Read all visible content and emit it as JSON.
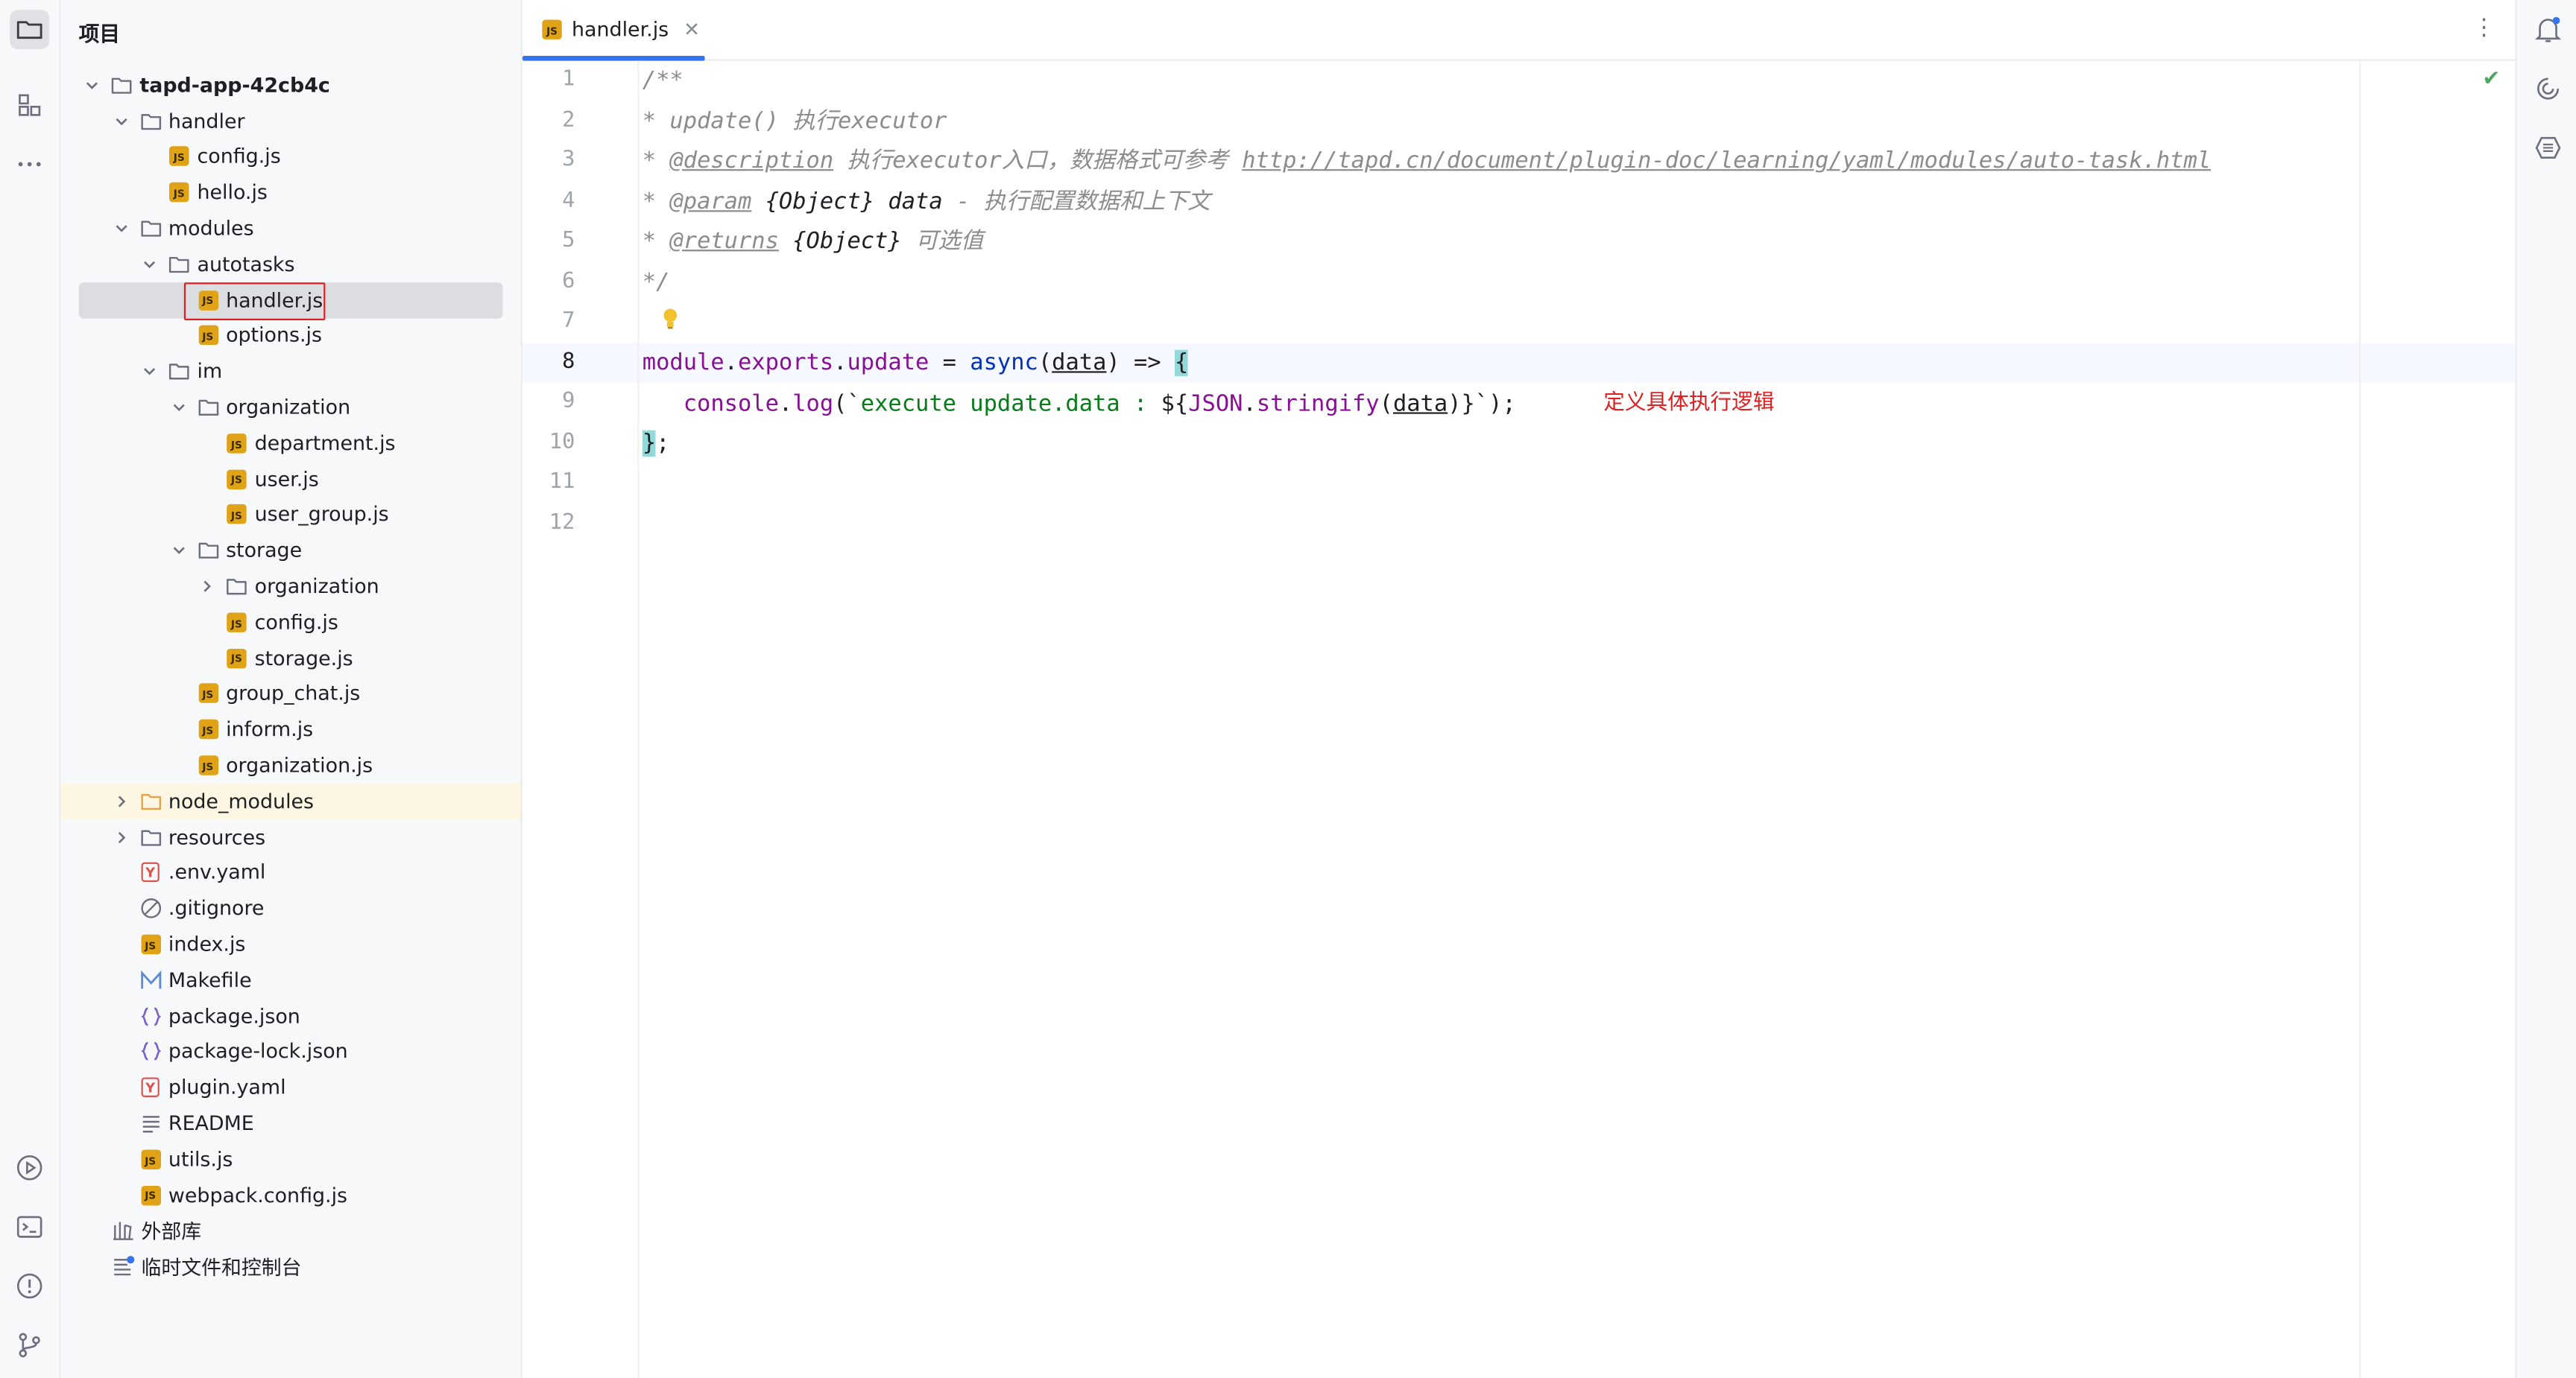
{
  "project_panel": {
    "title": "项目"
  },
  "tree": [
    {
      "label": "tapd-app-42cb4c",
      "depth": 0,
      "type": "folder",
      "expanded": true,
      "bold": true
    },
    {
      "label": "handler",
      "depth": 1,
      "type": "folder",
      "expanded": true
    },
    {
      "label": "config.js",
      "depth": 2,
      "type": "js"
    },
    {
      "label": "hello.js",
      "depth": 2,
      "type": "js"
    },
    {
      "label": "modules",
      "depth": 1,
      "type": "folder",
      "expanded": true
    },
    {
      "label": "autotasks",
      "depth": 2,
      "type": "folder",
      "expanded": true
    },
    {
      "label": "handler.js",
      "depth": 3,
      "type": "js",
      "selected": true
    },
    {
      "label": "options.js",
      "depth": 3,
      "type": "js"
    },
    {
      "label": "im",
      "depth": 2,
      "type": "folder",
      "expanded": true
    },
    {
      "label": "organization",
      "depth": 3,
      "type": "folder",
      "expanded": true
    },
    {
      "label": "department.js",
      "depth": 4,
      "type": "js"
    },
    {
      "label": "user.js",
      "depth": 4,
      "type": "js"
    },
    {
      "label": "user_group.js",
      "depth": 4,
      "type": "js"
    },
    {
      "label": "storage",
      "depth": 3,
      "type": "folder",
      "expanded": true
    },
    {
      "label": "organization",
      "depth": 4,
      "type": "folder",
      "expanded": false
    },
    {
      "label": "config.js",
      "depth": 4,
      "type": "js"
    },
    {
      "label": "storage.js",
      "depth": 4,
      "type": "js"
    },
    {
      "label": "group_chat.js",
      "depth": 3,
      "type": "js"
    },
    {
      "label": "inform.js",
      "depth": 3,
      "type": "js"
    },
    {
      "label": "organization.js",
      "depth": 3,
      "type": "js"
    },
    {
      "label": "node_modules",
      "depth": 1,
      "type": "folder-orange",
      "expanded": false,
      "highlight": true
    },
    {
      "label": "resources",
      "depth": 1,
      "type": "folder",
      "expanded": false
    },
    {
      "label": ".env.yaml",
      "depth": 1,
      "type": "yaml"
    },
    {
      "label": ".gitignore",
      "depth": 1,
      "type": "ignore"
    },
    {
      "label": "index.js",
      "depth": 1,
      "type": "js"
    },
    {
      "label": "Makefile",
      "depth": 1,
      "type": "make"
    },
    {
      "label": "package.json",
      "depth": 1,
      "type": "json"
    },
    {
      "label": "package-lock.json",
      "depth": 1,
      "type": "json"
    },
    {
      "label": "plugin.yaml",
      "depth": 1,
      "type": "yaml"
    },
    {
      "label": "README",
      "depth": 1,
      "type": "text"
    },
    {
      "label": "utils.js",
      "depth": 1,
      "type": "js"
    },
    {
      "label": "webpack.config.js",
      "depth": 1,
      "type": "js"
    },
    {
      "label": "外部库",
      "depth": 0,
      "type": "library",
      "noindent": true
    },
    {
      "label": "临时文件和控制台",
      "depth": 0,
      "type": "scratch",
      "noindent": true
    }
  ],
  "editor": {
    "tab_label": "handler.js",
    "line_numbers": [
      "1",
      "2",
      "3",
      "4",
      "5",
      "6",
      "7",
      "8",
      "9",
      "10",
      "11",
      "12"
    ],
    "current_line": "8",
    "code": {
      "l1": "/**",
      "l2": "* update() 执行executor",
      "l3_star": "* ",
      "l3_tag": "@description",
      "l3_text": " 执行executor入口，数据格式可参考 ",
      "l3_link": "http://tapd.cn/document/plugin-doc/learning/yaml/modules/auto-task.html",
      "l4_star": "* ",
      "l4_tag": "@param",
      "l4_type": " {Object}",
      "l4_name": " data",
      "l4_text": " - 执行配置数据和上下文",
      "l5_star": "* ",
      "l5_tag": "@returns",
      "l5_type": " {Object}",
      "l5_text": " 可选值",
      "l6": "*/",
      "l8_module": "module",
      "l8_dot1": ".",
      "l8_exports": "exports",
      "l8_dot2": ".",
      "l8_update": "update",
      "l8_eq": " = ",
      "l8_async": "async",
      "l8_paren_open": "(",
      "l8_data": "data",
      "l8_arrow": ") => ",
      "l8_brace": "{",
      "l9_indent": "   ",
      "l9_console": "console",
      "l9_dot": ".",
      "l9_log": "log",
      "l9_open": "(`",
      "l9_str": "execute update.data : ",
      "l9_interp_open": "${",
      "l9_json": "JSON",
      "l9_dot2": ".",
      "l9_stringify": "stringify",
      "l9_p_open": "(",
      "l9_data": "data",
      "l9_p_close": ")",
      "l9_interp_close": "}",
      "l9_end": "`);",
      "l10_brace": "}",
      "l10_semi": ";"
    },
    "annotation": "定义具体执行逻辑"
  },
  "colors": {
    "accent": "#3574f0",
    "annotation_red": "#e02020",
    "js_badge": "#e0a216",
    "keyword": "#0033b3",
    "property": "#871094",
    "string": "#067d17"
  },
  "icons": {
    "left_strip": [
      "folder-icon",
      "structure-icon",
      "more-icon",
      "run-icon",
      "terminal-icon",
      "problems-icon",
      "git-icon"
    ],
    "right_strip": [
      "notifications-icon",
      "ai-assistant-icon",
      "code-with-me-icon"
    ]
  }
}
